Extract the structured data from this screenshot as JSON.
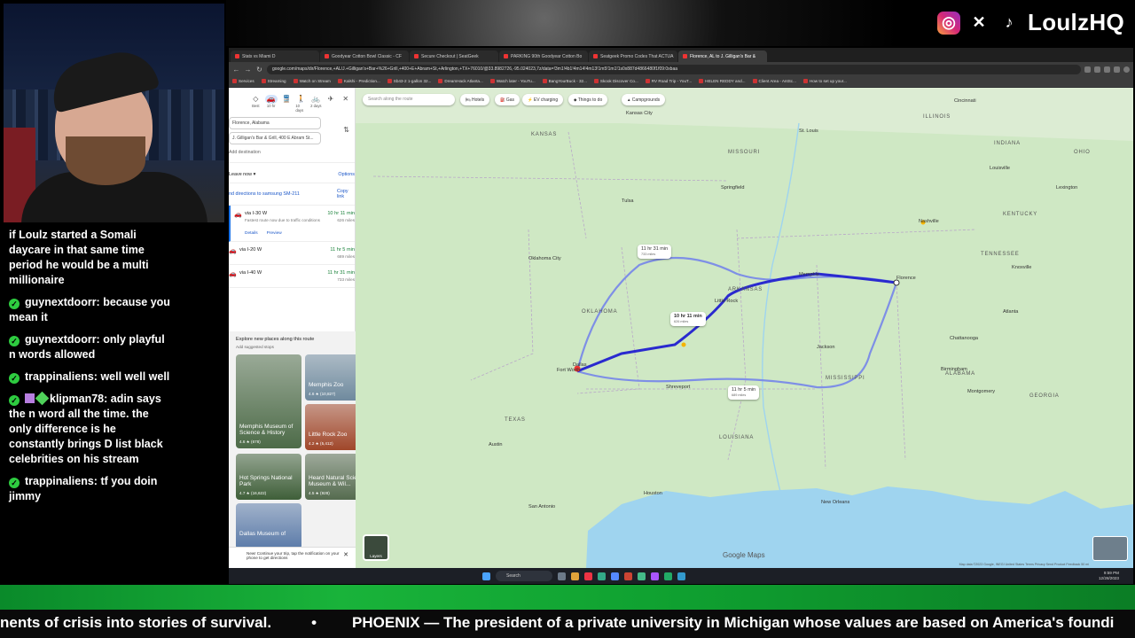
{
  "overlay": {
    "brand_name": "LoulzHQ",
    "ticker_left": "nents of crisis into stories of survival.",
    "ticker_bullet": "•",
    "ticker_right": "PHOENIX — The president of a private university in Michigan whose values are based on America's foundi"
  },
  "chat": [
    {
      "user": "",
      "text": "if Loulz started a Somali daycare in that same time period he would be a multi millionaire"
    },
    {
      "user": "guynextdoorr:",
      "text": "because you mean it"
    },
    {
      "user": "guynextdoorr:",
      "text": "only playful n words allowed"
    },
    {
      "user": "trappinaliens:",
      "text": "well well well"
    },
    {
      "user": "klipman78:",
      "text": "adin says the n word all the time. the only difference is he constantly brings D list black celebrities on his stream"
    },
    {
      "user": "trappinaliens:",
      "text": "tf you doin jimmy"
    }
  ],
  "browser": {
    "tabs": [
      "Stats vs Miami D",
      "Goodyear Cotton Bowl Classic - CF",
      "Secure Checkout | SeatGeek",
      "PARKING 90th Goodyear Cotton Bo",
      "Seatgeek Promo Codes That ACTUA",
      "Florence, AL to J. Gilligan's Bar &"
    ],
    "active_tab": 5,
    "url": "google.com/maps/dir/Florence,+AL/J.+Gilligan's+Bar+%26+Grill,+400+E+Abram+St,+Arlington,+TX+76010/@33.8982726,-95.024023,7z/data=!3m1!4b1!4m14!4m13!1m5!1m1!1s0x887d4866480f1f09:0xbaa",
    "bookmarks": [
      "Services",
      "Streaming",
      "Watch on Stream",
      "Kalshi - Prediction...",
      "Sb43-2 1-gallon 32...",
      "DreamHack Atlanta...",
      "Watch later - YouTu...",
      "BangYourBuck - 32...",
      "Skook Discover Co...",
      "RV Road Trip - YouT...",
      "HELEN REDDY and...",
      "Client Area - AntSc...",
      "How to set up your..."
    ]
  },
  "maps_panel": {
    "modes": [
      {
        "icon": "◇",
        "label": "Best"
      },
      {
        "icon": "🚗",
        "label": "10 hr"
      },
      {
        "icon": "🚆",
        "label": ""
      },
      {
        "icon": "🚶",
        "label": "10 days"
      },
      {
        "icon": "🚲",
        "label": "2 days"
      },
      {
        "icon": "✈",
        "label": ""
      }
    ],
    "origin": "Florence, Alabama",
    "destination": "J. Gilligan's Bar & Grill, 400 E Abram St...",
    "add_destination": "Add destination",
    "leave_now": "Leave now ▾",
    "options": "Options",
    "send_directions": "nd directions to samsung SM-211",
    "copy_link": "Copy link",
    "routes": [
      {
        "name": "via I-30 W",
        "sub": "Fastest route now due to traffic conditions",
        "time": "10 hr 11 min",
        "dist": "626 miles"
      },
      {
        "name": "via I-20 W",
        "sub": "",
        "time": "11 hr 5 min",
        "dist": "689 miles"
      },
      {
        "name": "via I-40 W",
        "sub": "",
        "time": "11 hr 31 min",
        "dist": "733 miles"
      }
    ],
    "details": "Details",
    "preview": "Preview",
    "explore_title": "Explore new places along this route",
    "explore_sub": "Add suggested stops",
    "places": [
      {
        "name": "Memphis Museum of Science & History",
        "rating": "4.6 ★ (678)",
        "color": "#4d6b48"
      },
      {
        "name": "Memphis Zoo",
        "rating": "4.6 ★ (10,827)",
        "color": "#6f8a9e"
      },
      {
        "name": "Little Rock Zoo",
        "rating": "4.2 ★ (5,412)",
        "color": "#a0472a"
      },
      {
        "name": "Hot Springs National Park",
        "rating": "4.7 ★ (16,622)",
        "color": "#3f5f39"
      },
      {
        "name": "Heard Natural Science Museum & Wil...",
        "rating": "4.5 ★ (928)",
        "color": "#556b4f"
      },
      {
        "name": "Dallas Museum of",
        "rating": "",
        "color": "#5a7aa8"
      }
    ],
    "notice": "New! Continue your trip, tap the notification on your phone to get directions"
  },
  "map": {
    "search_placeholder": "Search along the route",
    "chips": [
      "Hotels",
      "Gas",
      "EV charging",
      "Things to do",
      "Campgrounds"
    ],
    "route_labels": [
      {
        "time": "11 hr 31 min",
        "dist": "733 miles"
      },
      {
        "time": "10 hr 11 min",
        "dist": "626 miles"
      },
      {
        "time": "11 hr 5 min",
        "dist": "689 miles"
      }
    ],
    "cities": [
      "Kansas City",
      "St. Louis",
      "Cincinnati",
      "Oklahoma City",
      "Nashville",
      "Florence",
      "Atlanta",
      "Fort Worth",
      "Dallas",
      "Jackson",
      "Houston",
      "San Antonio",
      "Austin",
      "New Orleans",
      "Memphis",
      "Little Rock",
      "Tulsa",
      "Springfield",
      "Louisville",
      "Lexington",
      "Knoxville",
      "Chattanooga",
      "Birmingham",
      "Montgomery",
      "Shreveport"
    ],
    "states": [
      "KANSAS",
      "MISSOURI",
      "OKLAHOMA",
      "ARKANSAS",
      "TENNESSEE",
      "MISSISSIPPI",
      "ALABAMA",
      "GEORGIA",
      "TEXAS",
      "LOUISIANA",
      "ILLINOIS",
      "INDIANA",
      "KENTUCKY",
      "OHIO"
    ],
    "layers": "Layers",
    "google_logo": "Google Maps",
    "attribution": "Map data ©2023 Google, INEGI   United States   Terms   Privacy   Send Product Feedback   50 mi"
  },
  "taskbar": {
    "search": "Search",
    "time": "9:59 PM",
    "date": "12/28/2023"
  },
  "colors": {
    "route_main": "#2a2acf",
    "route_alt": "#7e8fe6",
    "water": "#9fd4ef",
    "land": "#cfe8c4",
    "green_band": "#19b33a"
  }
}
